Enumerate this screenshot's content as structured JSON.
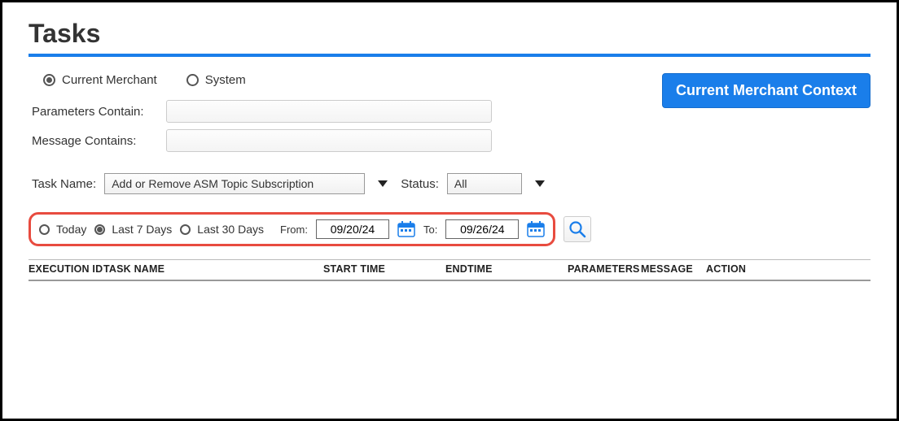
{
  "page": {
    "title": "Tasks"
  },
  "scope": {
    "current_merchant": "Current Merchant",
    "system": "System",
    "selected": "current_merchant"
  },
  "context_button": "Current Merchant Context",
  "filters": {
    "parameters_contain_label": "Parameters Contain:",
    "parameters_contain_value": "",
    "message_contains_label": "Message Contains:",
    "message_contains_value": "",
    "task_name_label": "Task Name:",
    "task_name_value": "Add or Remove ASM Topic Subscription",
    "status_label": "Status:",
    "status_value": "All"
  },
  "date_filter": {
    "today": "Today",
    "last7": "Last 7 Days",
    "last30": "Last 30 Days",
    "selected": "last7",
    "from_label": "From:",
    "from_value": "09/20/24",
    "to_label": "To:",
    "to_value": "09/26/24"
  },
  "table": {
    "headers": {
      "execution_id": "EXECUTION ID",
      "task_name": "TASK NAME",
      "start_time": "START TIME",
      "end_time": "ENDTIME",
      "parameters": "PARAMETERS",
      "message": "MESSAGE",
      "action": "ACTION"
    }
  }
}
